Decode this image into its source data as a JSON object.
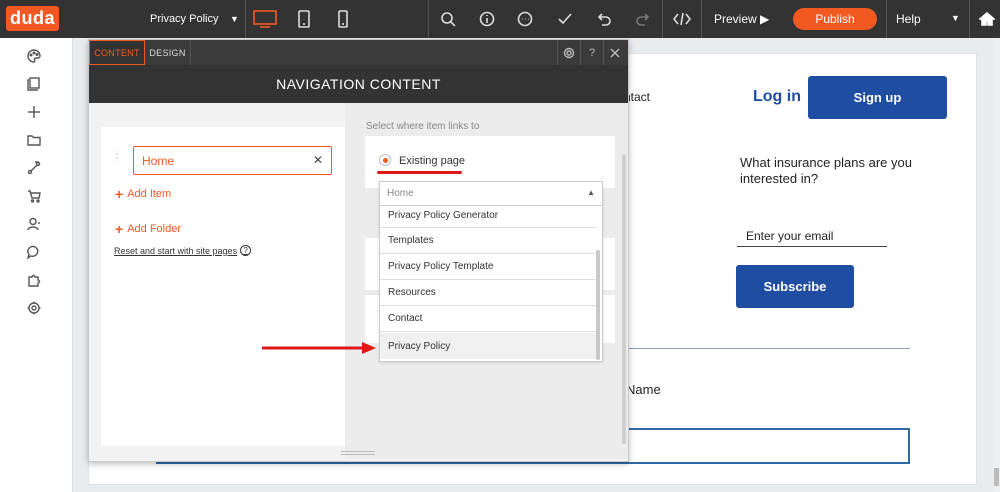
{
  "app": {
    "logo": "duda",
    "brand_color": "#f25922"
  },
  "toolbar": {
    "page_name": "Privacy Policy",
    "preview_label": "Preview ▶",
    "publish_label": "Publish",
    "help_label": "Help",
    "icons": [
      "desktop-icon",
      "tablet-icon",
      "mobile-icon",
      "search-icon",
      "info-icon",
      "comment-icon",
      "check-icon",
      "undo-icon",
      "redo-icon",
      "code-icon"
    ]
  },
  "rail": {
    "icons": [
      "palette-icon",
      "pages-icon",
      "add-icon",
      "folder-icon",
      "connect-icon",
      "cart-icon",
      "user-icon",
      "chat-icon",
      "puzzle-icon",
      "settings-icon"
    ]
  },
  "panel": {
    "tab_content": "CONTENT",
    "tab_design": "DESIGN",
    "title": "NAVIGATION CONTENT",
    "nav_items": [
      {
        "label": "Home"
      }
    ],
    "add_item": "Add Item",
    "add_folder": "Add Folder",
    "reset": "Reset and start with site pages",
    "select_label": "Select where item links to",
    "existing_page": "Existing page",
    "dropdown": {
      "value": "Home",
      "options": [
        "Privacy Policy Generator",
        "Templates",
        "Privacy Policy Template",
        "Resources",
        "Contact",
        "Privacy Policy"
      ],
      "highlighted": "Privacy Policy"
    }
  },
  "site": {
    "contact": "ntact",
    "login": "Log in",
    "signup": "Sign up",
    "question": "What insurance plans are you interested in?",
    "email_placeholder": "Enter your email",
    "subscribe": "Subscribe",
    "name_label": "Name",
    "accent_color": "#1e4da1"
  }
}
